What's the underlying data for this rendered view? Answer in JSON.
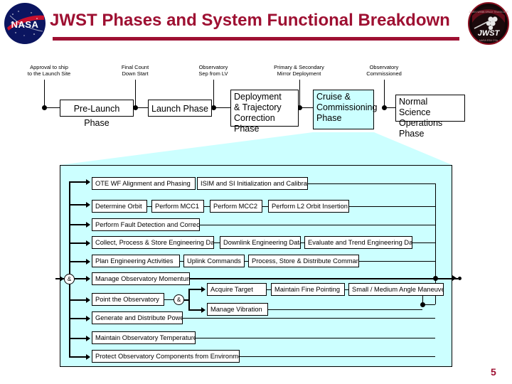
{
  "slide": {
    "title": "JWST Phases and System Functional Breakdown",
    "number": "5",
    "accent_color": "#9e1032",
    "highlight_color": "#ccffff",
    "logos": {
      "left": "nasa-meatball-logo",
      "right": "jwst-mission-patch-logo"
    }
  },
  "phase_timeline": {
    "milestones": [
      {
        "id": "m1",
        "label": "Approval to ship\nto the Launch Site"
      },
      {
        "id": "m2",
        "label": "Final Count\nDown Start"
      },
      {
        "id": "m3",
        "label": "Observatory\nSep from LV"
      },
      {
        "id": "m4",
        "label": "Primary & Secondary\nMirror Deployment"
      },
      {
        "id": "m5",
        "label": "Observatory\nCommissioned"
      }
    ],
    "phases": [
      {
        "id": "p1",
        "label": "Pre-Launch Phase",
        "highlighted": false
      },
      {
        "id": "p2",
        "label": "Launch Phase",
        "highlighted": false
      },
      {
        "id": "p3",
        "label": "Deployment\n& Trajectory\nCorrection Phase",
        "highlighted": false
      },
      {
        "id": "p4",
        "label": "Cruise &\nCommissioning\nPhase",
        "highlighted": true
      },
      {
        "id": "p5",
        "label": "Normal Science\nOperations Phase",
        "highlighted": false
      }
    ]
  },
  "functional_breakdown": {
    "junction_label": "&",
    "rows": [
      {
        "id": "r1",
        "functions": [
          "OTE WF Alignment and Phasing",
          "ISIM and SI Initialization and Calibration"
        ]
      },
      {
        "id": "r2",
        "functions": [
          "Determine Orbit",
          "Perform MCC1",
          "Perform MCC2",
          "Perform L2 Orbit Insertion"
        ]
      },
      {
        "id": "r3",
        "functions": [
          "Perform Fault Detection and Correction"
        ]
      },
      {
        "id": "r4",
        "functions": [
          "Collect, Process & Store Engineering Data",
          "Downlink Engineering Data",
          "Evaluate and Trend Engineering Data"
        ]
      },
      {
        "id": "r5",
        "functions": [
          "Plan Engineering Activities",
          "Uplink Commands",
          "Process, Store & Distribute Commands"
        ]
      },
      {
        "id": "r6",
        "functions": [
          "Manage Observatory Momentum"
        ]
      },
      {
        "id": "r7",
        "functions": [
          "Point the Observatory"
        ],
        "sub_rows": [
          {
            "id": "r7a",
            "functions": [
              "Acquire Target",
              "Maintain Fine Pointing",
              "Small / Medium Angle Maneuver"
            ]
          },
          {
            "id": "r7b",
            "functions": [
              "Manage Vibration"
            ]
          }
        ]
      },
      {
        "id": "r8",
        "functions": [
          "Generate and Distribute Power"
        ]
      },
      {
        "id": "r9",
        "functions": [
          "Maintain Observatory Temperatures"
        ]
      },
      {
        "id": "r10",
        "functions": [
          "Protect Observatory Components from Environments"
        ]
      }
    ]
  }
}
